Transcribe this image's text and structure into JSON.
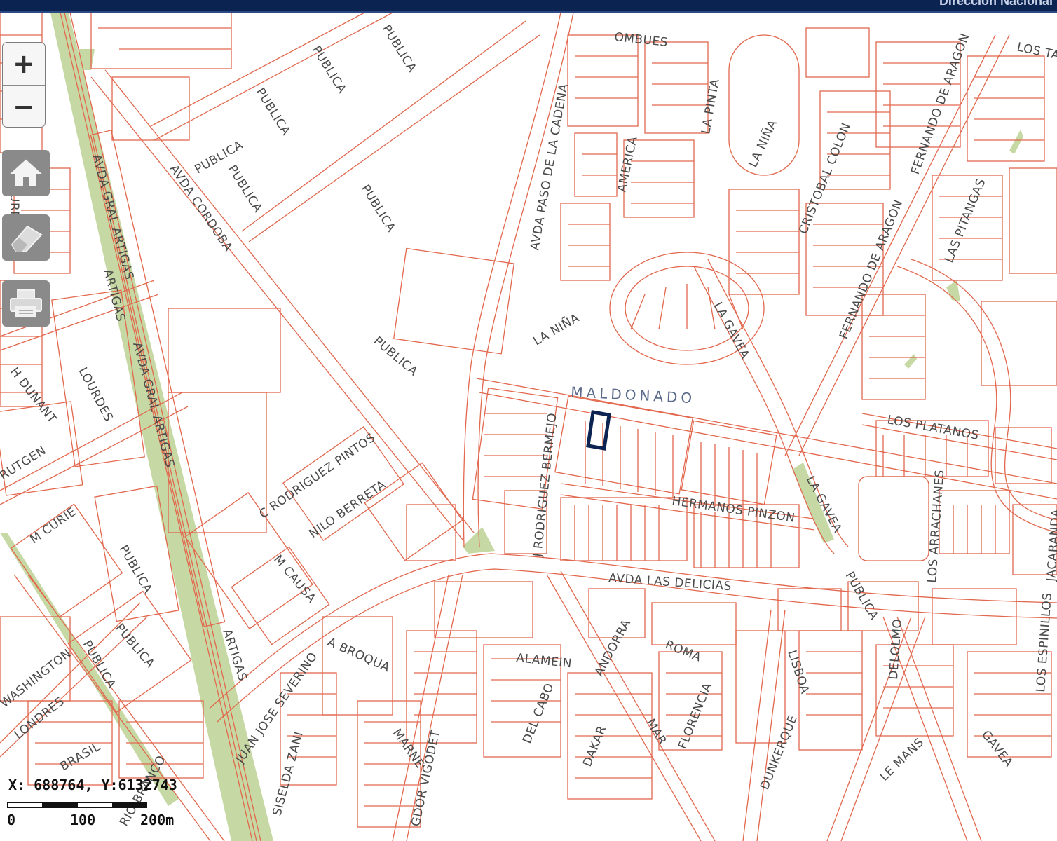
{
  "header": {
    "title": "Dirección Nacional"
  },
  "controls": {
    "zoom_in": "+",
    "zoom_out": "−"
  },
  "status": {
    "coordinates": "X: 688764, Y:6132743"
  },
  "scalebar": {
    "labels": [
      "0",
      "100",
      "200m"
    ]
  },
  "map": {
    "highlight_street": "MALDONADO",
    "street_labels": [
      "OMBUES",
      "LOS TA",
      "PUBLICA",
      "PUBLICA",
      "PUBLICA",
      "PUBLICA",
      "PUBLICA",
      "PUBLICA",
      "AVDA CORDOBA",
      "AVDA PASO DE LA CADENA",
      "AMERICA",
      "LA PINTA",
      "LA NIÑA",
      "CRISTOBAL COLON",
      "FERNANDO DE ARAGON",
      "FERNANDO DE ARAGON",
      "LAS PITANGAS",
      "LA NIÑA",
      "LA GAVEA",
      "PUBLICA",
      "AVDA GRAL ARTIGAS",
      "ARTIGAS",
      "AVDA GRAL ARTIGAS",
      "H DUNANT",
      "LOURDES",
      "RUTGEN",
      "M CURIE",
      "C RODRIGUEZ PINTOS",
      "NILO BERRETA",
      "J RODRIGUEZ BERMEJO",
      "HERMANOS PINZON",
      "LOS PLATANOS",
      "LA GAVEA",
      "LOS ARRACHANES",
      "JACARANDA",
      "M CAUSA",
      "PUBLICA",
      "AVDA LAS DELICIAS",
      "PUBLICA",
      "PUBLICA",
      "ARTIGAS",
      "A BROQUA",
      "ALAMEIN",
      "ANDORRA",
      "ROMA",
      "LISBOA",
      "DELOLMO",
      "LOS ESPINILLOS",
      "WASHINGTON",
      "LONDRES",
      "PUBLICA",
      "BRASIL",
      "RIO BRANCO",
      "JUAN JOSE SEVERINO",
      "SISELDA ZANI",
      "MARNE",
      "GDOR VIGODET",
      "DEL CABO",
      "DAKAR",
      "MAR",
      "FLORENCIA",
      "DUNKERQUE",
      "LE MANS",
      "GAVEA",
      "URD"
    ]
  },
  "icons": {
    "home": "home-icon",
    "eraser": "eraser-icon",
    "print": "printer-icon"
  },
  "colors": {
    "parcel_line": "#e2674d",
    "green_area": "#c6d9a4",
    "selection": "#0d2452",
    "header_bg": "#0b2350"
  }
}
